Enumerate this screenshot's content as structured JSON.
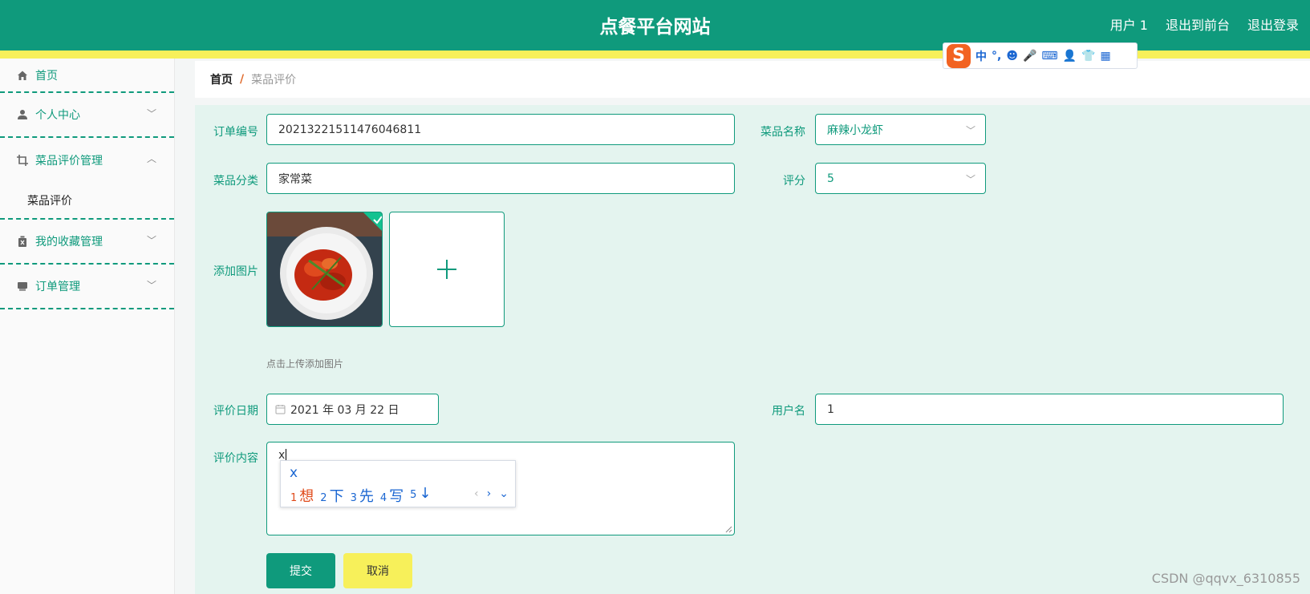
{
  "header": {
    "title": "点餐平台网站",
    "links": [
      "用户 1",
      "退出到前台",
      "退出登录"
    ]
  },
  "sidebar": {
    "items": [
      {
        "label": "首页",
        "icon": "home-icon"
      },
      {
        "label": "个人中心",
        "icon": "user-icon"
      },
      {
        "label": "菜品评价管理",
        "icon": "crop-icon",
        "children": [
          "菜品评价"
        ]
      },
      {
        "label": "我的收藏管理",
        "icon": "trash-icon"
      },
      {
        "label": "订单管理",
        "icon": "printer-icon"
      }
    ]
  },
  "breadcrumb": {
    "home": "首页",
    "separator": "/",
    "current": "菜品评价"
  },
  "form": {
    "order_no": {
      "label": "订单编号",
      "value": "20213221511476046811"
    },
    "dish_name": {
      "label": "菜品名称",
      "value": "麻辣小龙虾"
    },
    "category": {
      "label": "菜品分类",
      "value": "家常菜"
    },
    "score": {
      "label": "评分",
      "value": "5"
    },
    "image": {
      "label": "添加图片",
      "hint": "点击上传添加图片"
    },
    "date": {
      "label": "评价日期",
      "value": "2021 年 03 月 22 日"
    },
    "username": {
      "label": "用户名",
      "value": "1"
    },
    "content": {
      "label": "评价内容",
      "value": "x"
    },
    "submit": "提交",
    "cancel": "取消"
  },
  "ime": {
    "toolbar": [
      "中",
      "°,",
      "☻",
      "🎤",
      "⌨",
      "👤",
      "👕",
      "▦"
    ],
    "typed": "x",
    "candidates": [
      {
        "n": "1",
        "t": "想"
      },
      {
        "n": "2",
        "t": "下"
      },
      {
        "n": "3",
        "t": "先"
      },
      {
        "n": "4",
        "t": "写"
      },
      {
        "n": "5",
        "t": "↓"
      }
    ]
  },
  "colors": {
    "primary": "#0f9a7c",
    "accent": "#f7f05a",
    "panel": "#e4f4ef"
  },
  "watermark": "CSDN @qqvx_6310855"
}
